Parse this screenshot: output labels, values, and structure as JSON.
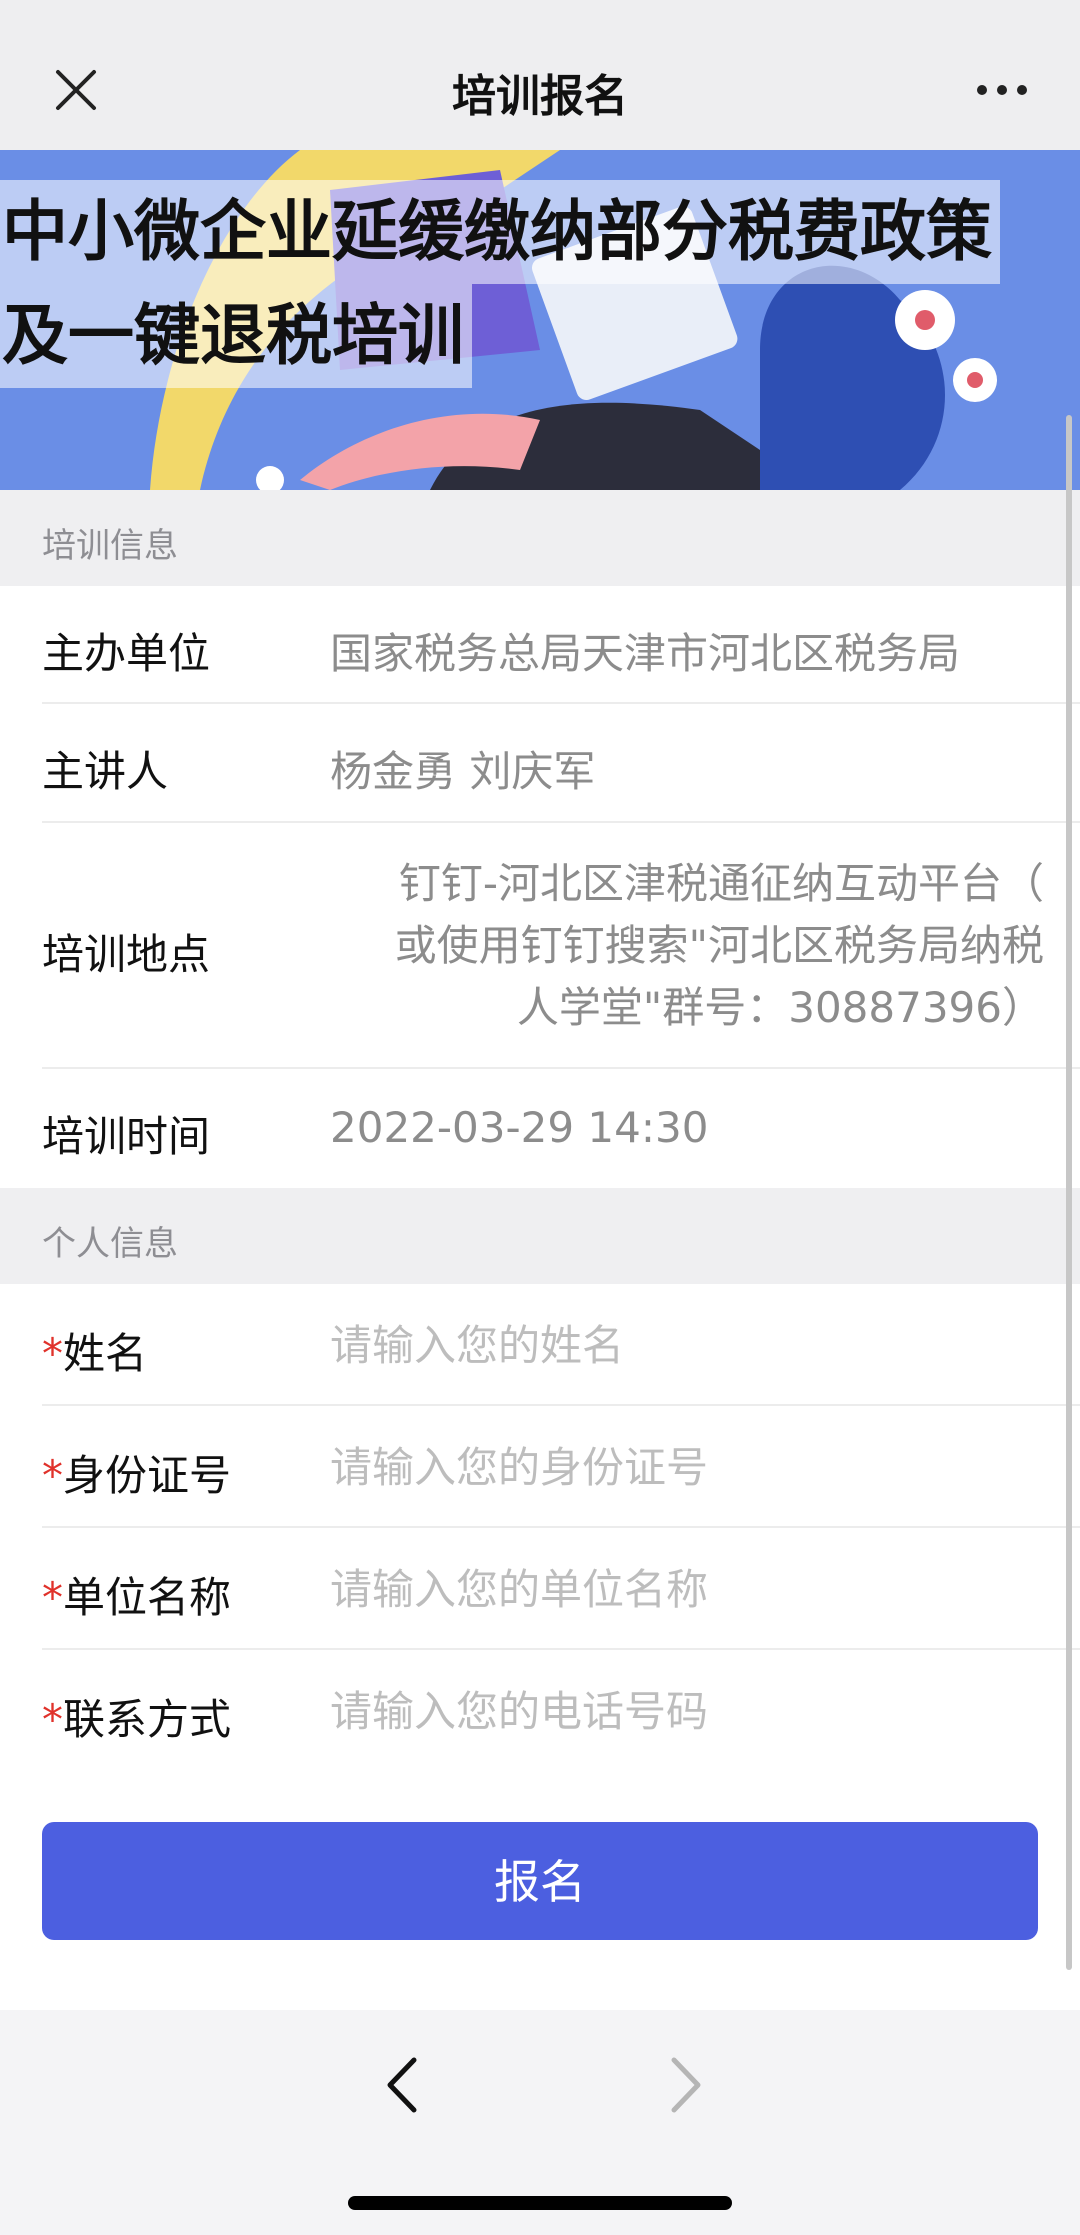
{
  "topbar": {
    "title": "培训报名",
    "close_icon": "close-icon",
    "more_icon": "more-horizontal-icon"
  },
  "banner": {
    "title_line1": "中小微企业延缓缴纳部分税费政策",
    "title_line2": "及一键退税培训"
  },
  "training_info": {
    "header": "培训信息",
    "rows": [
      {
        "label": "主办单位",
        "value": "国家税务总局天津市河北区税务局"
      },
      {
        "label": "主讲人",
        "value": "杨金勇 刘庆军"
      },
      {
        "label": "培训地点",
        "value_lines": [
          "钉钉-河北区津税通征纳互动平台（",
          "或使用钉钉搜索\"河北区税务局纳税",
          "人学堂\"群号：30887396）"
        ]
      },
      {
        "label": "培训时间",
        "value": "2022-03-29 14:30"
      }
    ]
  },
  "personal_info": {
    "header": "个人信息",
    "required_mark": "*",
    "fields": [
      {
        "label": "姓名",
        "placeholder": "请输入您的姓名",
        "value": ""
      },
      {
        "label": "身份证号",
        "placeholder": "请输入您的身份证号",
        "value": ""
      },
      {
        "label": "单位名称",
        "placeholder": "请输入您的单位名称",
        "value": ""
      },
      {
        "label": "联系方式",
        "placeholder": "请输入您的电话号码",
        "value": ""
      }
    ]
  },
  "submit_label": "报名",
  "colors": {
    "primary": "#4c5fe0",
    "required": "#e0322b",
    "banner_bg": "#5b7fd8"
  },
  "bottom_nav": {
    "back_icon": "chevron-left-icon",
    "forward_icon": "chevron-right-icon"
  }
}
